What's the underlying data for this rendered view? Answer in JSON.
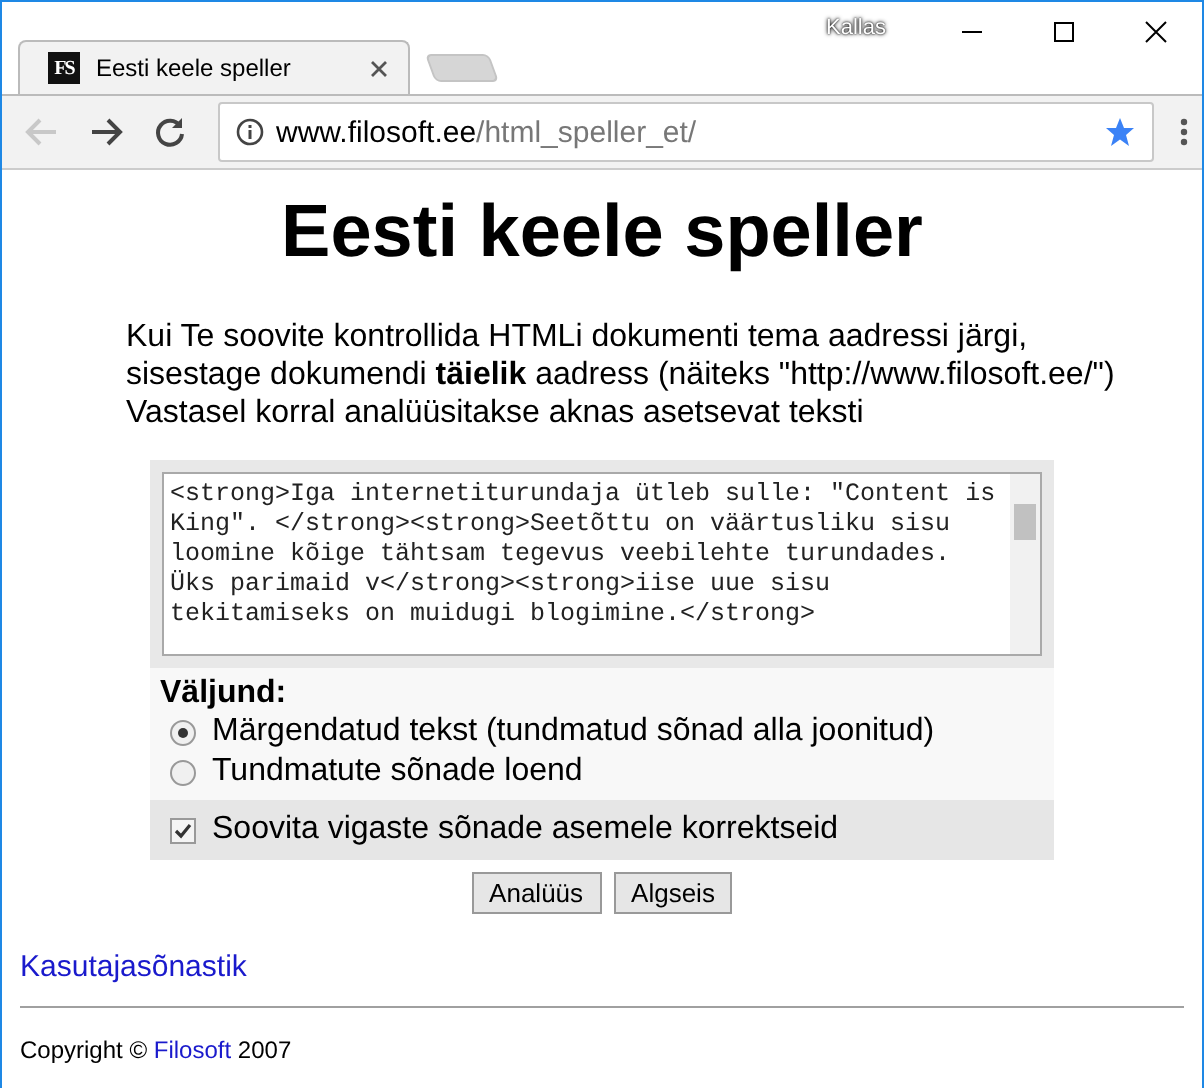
{
  "browser": {
    "user": "Kallas",
    "tab": {
      "title": "Eesti keele speller",
      "favicon": "FS"
    },
    "url": {
      "domain": "www.filosoft.ee",
      "path": "/html_speller_et/"
    }
  },
  "page": {
    "heading": "Eesti keele speller",
    "intro_lines": [
      "Kui Te soovite kontrollida HTMLi dokumenti tema aadressi järgi,",
      "sisestage dokumendi **täielik** aadress (näiteks \"http://www.filosoft.ee/\")",
      "Vastasel korral analüüsitakse aknas asetsevat teksti"
    ],
    "input": {
      "value": "<strong>Iga internetiturundaja ütleb sulle: \"Content is King\". </strong><strong>Seetõttu on väärtusliku sisu loomine kõige tähtsam tegevus veebilehte turundades. Üks parimaid v</strong><strong>iise uue sisu tekitamiseks on muidugi blogimine.</strong>"
    },
    "output_label": "Väljund:",
    "output_options": [
      {
        "label": "Märgendatud tekst (tundmatud sõnad alla joonitud)",
        "selected": true
      },
      {
        "label": "Tundmatute sõnade loend",
        "selected": false
      }
    ],
    "suggest": {
      "label": "Soovita vigaste sõnade asemele korrektseid",
      "checked": true
    },
    "buttons": [
      "Analüüs",
      "Algseis"
    ],
    "link": "Kasutajasõnastik",
    "footer": {
      "prefix": "Copyright ©",
      "link": "Filosoft",
      "suffix": "2007"
    }
  }
}
